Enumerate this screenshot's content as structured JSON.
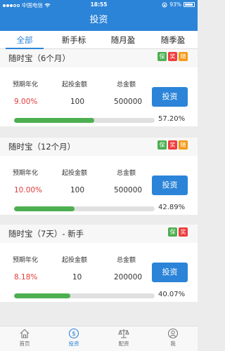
{
  "status": {
    "carrier": "中国电信",
    "time": "18:55",
    "battery": "93%"
  },
  "nav": {
    "title": "投资"
  },
  "tabs": [
    "全部",
    "新手标",
    "随月盈",
    "随季盈"
  ],
  "labels": {
    "rate": "预期年化",
    "min": "起投金额",
    "total": "总金额",
    "invest": "投资"
  },
  "products": [
    {
      "title": "随时宝（6个月）",
      "badges": [
        "保",
        "奖",
        "随"
      ],
      "rate": "9.00%",
      "min": "100",
      "total": "500000",
      "progress_text": "57.20%",
      "progress": 0.572
    },
    {
      "title": "随时宝（12个月）",
      "badges": [
        "保",
        "奖",
        "随"
      ],
      "rate": "10.00%",
      "min": "100",
      "total": "500000",
      "progress_text": "42.89%",
      "progress": 0.4289
    },
    {
      "title": "随时宝（7天）- 新手",
      "badges": [
        "保",
        "奖"
      ],
      "rate": "8.18%",
      "min": "10",
      "total": "200000",
      "progress_text": "40.07%",
      "progress": 0.4007
    }
  ],
  "tabbar": [
    {
      "label": "首页",
      "icon": "home-icon"
    },
    {
      "label": "投资",
      "icon": "invest-icon"
    },
    {
      "label": "配资",
      "icon": "scale-icon"
    },
    {
      "label": "我",
      "icon": "user-icon"
    }
  ],
  "colors": {
    "primary": "#2b84d8",
    "rate": "#e23b3b",
    "progress": "#4caf50",
    "badge_bao": "#4caf50",
    "badge_jiang": "#ef3b3b",
    "badge_sui": "#f49a16"
  }
}
